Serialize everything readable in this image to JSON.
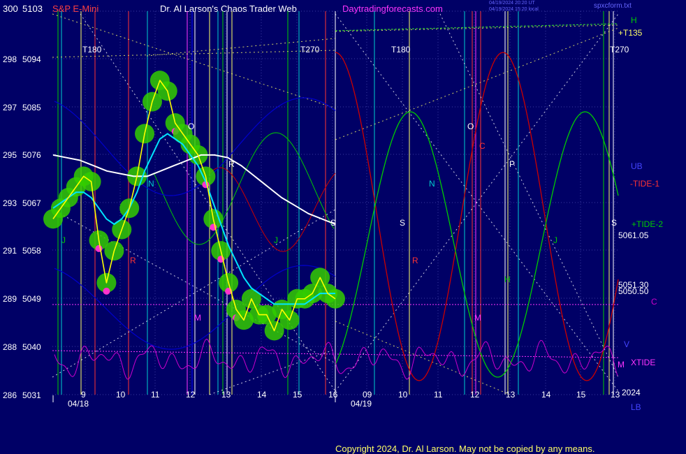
{
  "header": {
    "symbol": "S&P E-Mini",
    "site": "Dr. Al Larson's Chaos Trader Web",
    "url": "Daytradingforecasts.com",
    "timestamp_utc": "04/19/2024 20:20 UT",
    "timestamp_local": "04/19/2024 15:20 local",
    "filename": "spxcform.txt"
  },
  "colors": {
    "background": "#000066",
    "grid": "#3a3aa0",
    "price": "#ffff00",
    "ma_short": "#00e5ff",
    "ma_long": "#ffffff",
    "plus_tide1": "#00cc00",
    "minus_tide1": "#cc0000",
    "tide2": "#00cc00",
    "xtide": "#cc00cc",
    "bands": "#0000cc",
    "dots_bull": "#33cc00",
    "dots_bear": "#ff33cc"
  },
  "chart_data": {
    "type": "line",
    "title": "S&P E-Mini",
    "x_dates": [
      "04/18",
      "04/19"
    ],
    "x_ticks": [
      "9",
      "10",
      "11",
      "12",
      "13",
      "14",
      "15",
      "16",
      "09",
      "10",
      "11",
      "12",
      "13",
      "14",
      "15",
      "13"
    ],
    "y_ticks": [
      {
        "level": "300",
        "price": "5103"
      },
      {
        "level": "298",
        "price": "5094"
      },
      {
        "level": "297",
        "price": "5085"
      },
      {
        "level": "295",
        "price": "5076"
      },
      {
        "level": "293",
        "price": "5067"
      },
      {
        "level": "291",
        "price": "5058"
      },
      {
        "level": "289",
        "price": "5049"
      },
      {
        "level": "288",
        "price": "5040"
      },
      {
        "level": "286",
        "price": "5031"
      }
    ],
    "ylim": [
      5031,
      5103
    ],
    "series": [
      {
        "name": "price",
        "values": [
          5064,
          5066,
          5068,
          5070,
          5072,
          5071,
          5060,
          5052,
          5058,
          5062,
          5066,
          5072,
          5080,
          5086,
          5090,
          5088,
          5082,
          5080,
          5078,
          5076,
          5072,
          5064,
          5058,
          5052,
          5047,
          5045,
          5049,
          5046,
          5046,
          5043,
          5047,
          5045,
          5049,
          5049,
          5050,
          5053,
          5050,
          5049
        ]
      },
      {
        "name": "ma_short",
        "values": [
          5066,
          5067,
          5068,
          5069,
          5069,
          5068,
          5066,
          5064,
          5063,
          5064,
          5066,
          5069,
          5073,
          5076,
          5079,
          5080,
          5079,
          5078,
          5076,
          5074,
          5071,
          5067,
          5063,
          5059,
          5056,
          5053,
          5051,
          5050,
          5049,
          5048,
          5048,
          5048,
          5048,
          5048,
          5049,
          5050,
          5050,
          5050
        ]
      },
      {
        "name": "ma_long",
        "values": [
          5076,
          5075.5,
          5075,
          5074,
          5073,
          5072.5,
          5072,
          5072,
          5073,
          5074,
          5075,
          5076,
          5076,
          5075.5,
          5074,
          5072,
          5070,
          5068,
          5066.5,
          5065,
          5064,
          5063
        ]
      }
    ],
    "text_labels": {
      "cycle_marks": [
        "T180",
        "T270",
        "T180",
        "T270",
        "+T135"
      ],
      "letters": [
        "J",
        "R",
        "M",
        "N",
        "O",
        "R",
        "J",
        "S",
        "S",
        "N",
        "R",
        "O",
        "C",
        "P",
        "M",
        "H",
        "J",
        "S",
        "UB",
        "LB",
        "H",
        "V",
        "C"
      ],
      "tide_labels": [
        "-TIDE-1",
        "+TIDE-2",
        "XTIDE"
      ],
      "price_markers": [
        "5061.05",
        "5051.30",
        "5050.50"
      ],
      "year": "2024"
    }
  },
  "footer": {
    "copyright": "Copyright 2024, Dr. Al Larson. May not be copied by any means."
  }
}
